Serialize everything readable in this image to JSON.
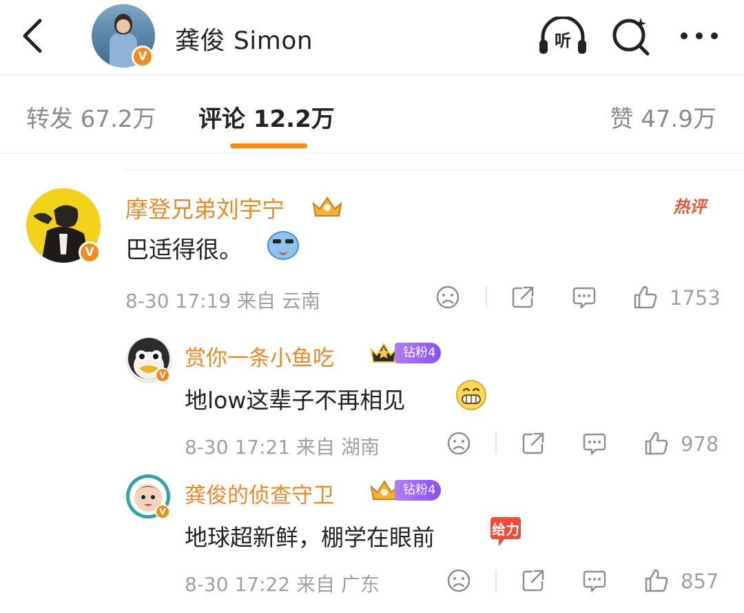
{
  "header": {
    "title": "龚俊 Simon",
    "avatar_badge": "V",
    "listen_label": "听"
  },
  "tabs": [
    {
      "label": "转发 67.2万"
    },
    {
      "label": "评论 12.2万"
    },
    {
      "label": "赞 47.9万"
    }
  ],
  "comments": [
    {
      "username": "摩登兄弟刘宇宁",
      "text": "巴适得很。",
      "hot_label": "热评",
      "meta": "8-30 17:19  来自 云南",
      "likes": "1753",
      "badge": "V"
    },
    {
      "username": "赏你一条小鱼吃",
      "fan_badge": "钻粉4",
      "text": "地low这辈子不再相见",
      "meta": "8-30 17:21  来自 湖南",
      "likes": "978",
      "badge": "V"
    },
    {
      "username": "龚俊的侦查守卫",
      "fan_badge": "钻粉4",
      "text": "地球超新鲜，棚学在眼前",
      "meta": "8-30 17:22  来自 广东",
      "likes": "857",
      "badge": "V",
      "sticker_text": "给力"
    }
  ],
  "colors": {
    "accent": "#f08c1d",
    "username": "#e68a2e",
    "hot": "#e8553e",
    "fan_badge": "#8a4ff0"
  }
}
